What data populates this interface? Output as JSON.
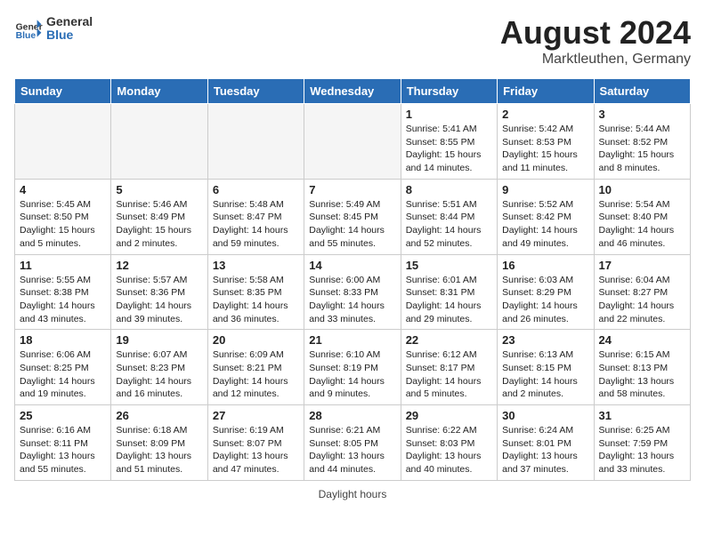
{
  "header": {
    "logo_general": "General",
    "logo_blue": "Blue",
    "month_year": "August 2024",
    "location": "Marktleuthen, Germany"
  },
  "days_of_week": [
    "Sunday",
    "Monday",
    "Tuesday",
    "Wednesday",
    "Thursday",
    "Friday",
    "Saturday"
  ],
  "weeks": [
    [
      {
        "day": "",
        "empty": true
      },
      {
        "day": "",
        "empty": true
      },
      {
        "day": "",
        "empty": true
      },
      {
        "day": "",
        "empty": true
      },
      {
        "day": "1",
        "sunrise": "5:41 AM",
        "sunset": "8:55 PM",
        "daylight": "15 hours and 14 minutes."
      },
      {
        "day": "2",
        "sunrise": "5:42 AM",
        "sunset": "8:53 PM",
        "daylight": "15 hours and 11 minutes."
      },
      {
        "day": "3",
        "sunrise": "5:44 AM",
        "sunset": "8:52 PM",
        "daylight": "15 hours and 8 minutes."
      }
    ],
    [
      {
        "day": "4",
        "sunrise": "5:45 AM",
        "sunset": "8:50 PM",
        "daylight": "15 hours and 5 minutes."
      },
      {
        "day": "5",
        "sunrise": "5:46 AM",
        "sunset": "8:49 PM",
        "daylight": "15 hours and 2 minutes."
      },
      {
        "day": "6",
        "sunrise": "5:48 AM",
        "sunset": "8:47 PM",
        "daylight": "14 hours and 59 minutes."
      },
      {
        "day": "7",
        "sunrise": "5:49 AM",
        "sunset": "8:45 PM",
        "daylight": "14 hours and 55 minutes."
      },
      {
        "day": "8",
        "sunrise": "5:51 AM",
        "sunset": "8:44 PM",
        "daylight": "14 hours and 52 minutes."
      },
      {
        "day": "9",
        "sunrise": "5:52 AM",
        "sunset": "8:42 PM",
        "daylight": "14 hours and 49 minutes."
      },
      {
        "day": "10",
        "sunrise": "5:54 AM",
        "sunset": "8:40 PM",
        "daylight": "14 hours and 46 minutes."
      }
    ],
    [
      {
        "day": "11",
        "sunrise": "5:55 AM",
        "sunset": "8:38 PM",
        "daylight": "14 hours and 43 minutes."
      },
      {
        "day": "12",
        "sunrise": "5:57 AM",
        "sunset": "8:36 PM",
        "daylight": "14 hours and 39 minutes."
      },
      {
        "day": "13",
        "sunrise": "5:58 AM",
        "sunset": "8:35 PM",
        "daylight": "14 hours and 36 minutes."
      },
      {
        "day": "14",
        "sunrise": "6:00 AM",
        "sunset": "8:33 PM",
        "daylight": "14 hours and 33 minutes."
      },
      {
        "day": "15",
        "sunrise": "6:01 AM",
        "sunset": "8:31 PM",
        "daylight": "14 hours and 29 minutes."
      },
      {
        "day": "16",
        "sunrise": "6:03 AM",
        "sunset": "8:29 PM",
        "daylight": "14 hours and 26 minutes."
      },
      {
        "day": "17",
        "sunrise": "6:04 AM",
        "sunset": "8:27 PM",
        "daylight": "14 hours and 22 minutes."
      }
    ],
    [
      {
        "day": "18",
        "sunrise": "6:06 AM",
        "sunset": "8:25 PM",
        "daylight": "14 hours and 19 minutes."
      },
      {
        "day": "19",
        "sunrise": "6:07 AM",
        "sunset": "8:23 PM",
        "daylight": "14 hours and 16 minutes."
      },
      {
        "day": "20",
        "sunrise": "6:09 AM",
        "sunset": "8:21 PM",
        "daylight": "14 hours and 12 minutes."
      },
      {
        "day": "21",
        "sunrise": "6:10 AM",
        "sunset": "8:19 PM",
        "daylight": "14 hours and 9 minutes."
      },
      {
        "day": "22",
        "sunrise": "6:12 AM",
        "sunset": "8:17 PM",
        "daylight": "14 hours and 5 minutes."
      },
      {
        "day": "23",
        "sunrise": "6:13 AM",
        "sunset": "8:15 PM",
        "daylight": "14 hours and 2 minutes."
      },
      {
        "day": "24",
        "sunrise": "6:15 AM",
        "sunset": "8:13 PM",
        "daylight": "13 hours and 58 minutes."
      }
    ],
    [
      {
        "day": "25",
        "sunrise": "6:16 AM",
        "sunset": "8:11 PM",
        "daylight": "13 hours and 55 minutes."
      },
      {
        "day": "26",
        "sunrise": "6:18 AM",
        "sunset": "8:09 PM",
        "daylight": "13 hours and 51 minutes."
      },
      {
        "day": "27",
        "sunrise": "6:19 AM",
        "sunset": "8:07 PM",
        "daylight": "13 hours and 47 minutes."
      },
      {
        "day": "28",
        "sunrise": "6:21 AM",
        "sunset": "8:05 PM",
        "daylight": "13 hours and 44 minutes."
      },
      {
        "day": "29",
        "sunrise": "6:22 AM",
        "sunset": "8:03 PM",
        "daylight": "13 hours and 40 minutes."
      },
      {
        "day": "30",
        "sunrise": "6:24 AM",
        "sunset": "8:01 PM",
        "daylight": "13 hours and 37 minutes."
      },
      {
        "day": "31",
        "sunrise": "6:25 AM",
        "sunset": "7:59 PM",
        "daylight": "13 hours and 33 minutes."
      }
    ]
  ],
  "footer": {
    "daylight_label": "Daylight hours"
  }
}
